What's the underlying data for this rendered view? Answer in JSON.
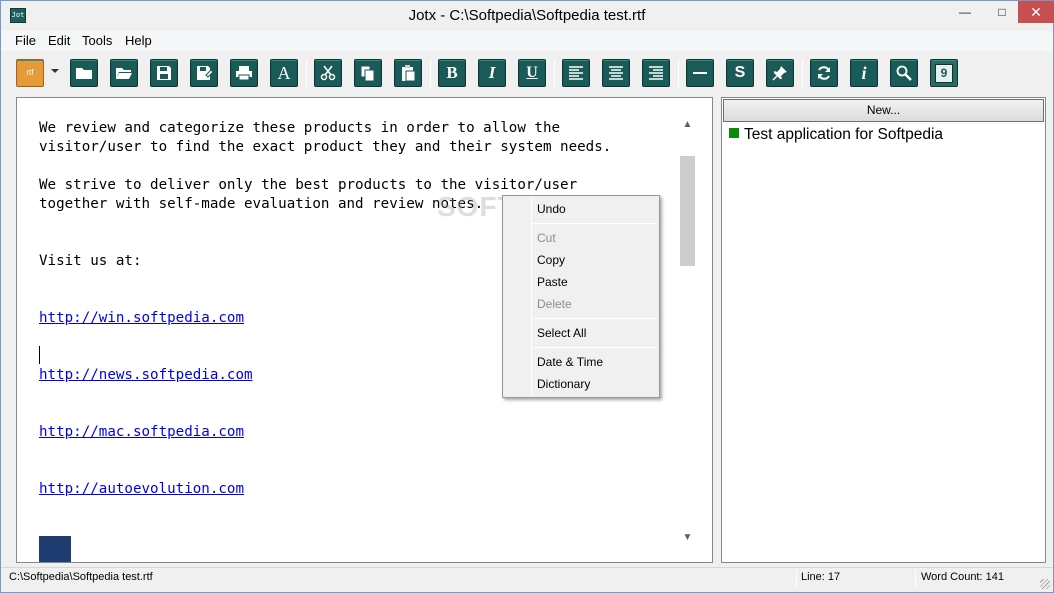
{
  "window": {
    "title": "Jotx - C:\\Softpedia\\Softpedia test.rtf",
    "app_icon_text": "Jot"
  },
  "menu": [
    "File",
    "Edit",
    "Tools",
    "Help"
  ],
  "toolbar": {
    "new_icon": "rtf",
    "buttons": [
      "new-document",
      "open-folder",
      "open-recent",
      "save",
      "save-as",
      "print",
      "font",
      "cut",
      "copy",
      "paste",
      "bold",
      "italic",
      "underline",
      "align-left",
      "align-center",
      "align-right",
      "horizontal-line",
      "spell-check",
      "pin",
      "refresh",
      "info",
      "search",
      "calendar"
    ],
    "bold_label": "B",
    "italic_label": "I",
    "underline_label": "U",
    "info_label": "i",
    "spell_label": "S",
    "calendar_label": "9"
  },
  "editor": {
    "line1": "We review and categorize these products in order to allow the",
    "line2": "visitor/user to find the exact product they and their system needs.",
    "line3": "We strive to deliver only the best products to the visitor/user",
    "line4": "together with self-made evaluation and review notes.",
    "line5": "Visit us at:",
    "links": [
      "http://win.softpedia.com",
      "http://news.softpedia.com",
      "http://mac.softpedia.com",
      "http://autoevolution.com"
    ]
  },
  "watermark": "SOFTPEDIA",
  "context_menu": {
    "undo": "Undo",
    "cut": "Cut",
    "copy": "Copy",
    "paste": "Paste",
    "delete": "Delete",
    "select_all": "Select All",
    "date_time": "Date & Time",
    "dictionary": "Dictionary"
  },
  "panel": {
    "new_button": "New...",
    "notes": [
      "Test application for Softpedia"
    ]
  },
  "status": {
    "path": "C:\\Softpedia\\Softpedia test.rtf",
    "line": "Line: 17",
    "word_count": "Word Count: 141"
  },
  "colors": {
    "toolbar_button": "#1a5a57",
    "new_button": "#e79a3a",
    "link": "#0000ee",
    "note_bullet": "#0a8a0a",
    "close_button": "#c74f4f"
  }
}
